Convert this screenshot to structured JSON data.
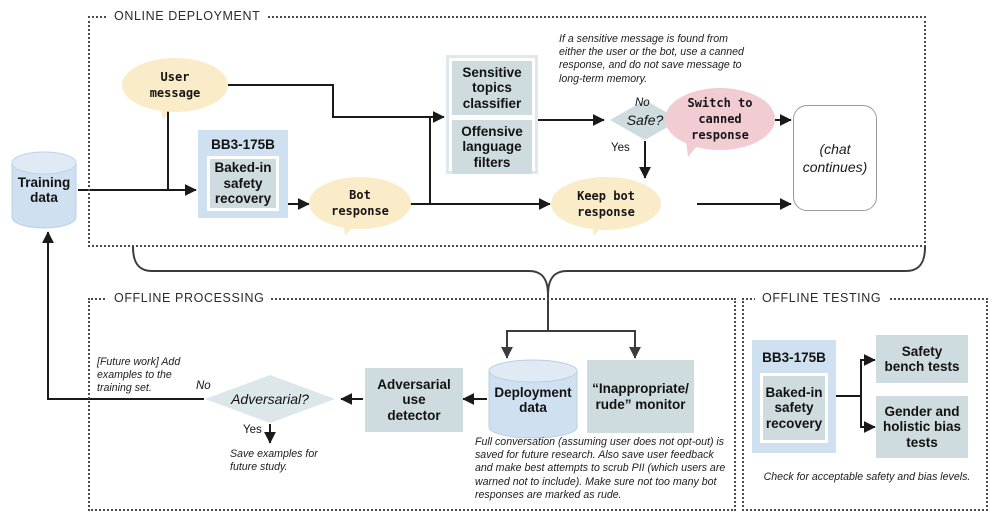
{
  "sections": {
    "online": {
      "label": "ONLINE DEPLOYMENT"
    },
    "offline_processing": {
      "label": "OFFLINE PROCESSING"
    },
    "offline_testing": {
      "label": "OFFLINE TESTING"
    }
  },
  "online": {
    "training_data": "Training\ndata",
    "user_message": "User\nmessage",
    "model_title": "BB3-175B",
    "model_inner": "Baked-in\nsafety\nrecovery",
    "bot_response": "Bot\nresponse",
    "classifier_top": "Sensitive\ntopics\nclassifier",
    "classifier_bottom": "Offensive\nlanguage\nfilters",
    "safe_decision": "Safe?",
    "label_no": "No",
    "label_yes": "Yes",
    "canned_response": "Switch to\ncanned\nresponse",
    "keep_bot_response": "Keep bot\nresponse",
    "chat_continues": "(chat\ncontinues)",
    "note_sensitive": "If a sensitive message is found from either the user or the bot, use a canned response, and do not save message to long-term memory."
  },
  "offline_processing": {
    "deployment_data": "Deployment\ndata",
    "rude_monitor": "“Inappropriate/\nrude” monitor",
    "adversarial_detector": "Adversarial\nuse\ndetector",
    "adversarial_decision": "Adversarial?",
    "label_no": "No",
    "label_yes": "Yes",
    "note_future_work": "[Future work] Add examples to the training set.",
    "note_save_examples": "Save examples for future study.",
    "note_full_conversation": "Full conversation (assuming user does not opt-out) is saved for future research. Also save user feedback and make best attempts to scrub PII (which users are warned not to include). Make sure not too many bot responses are marked as rude."
  },
  "offline_testing": {
    "model_title": "BB3-175B",
    "model_inner": "Baked-in\nsafety\nrecovery",
    "safety_bench": "Safety\nbench tests",
    "bias_tests": "Gender and\nholistic bias\ntests",
    "note_check": "Check for acceptable safety and bias levels."
  },
  "colors": {
    "blue_fill": "#cfe0f1",
    "grayblue_fill": "#cfdcdf",
    "yellow_bubble": "#faecc8",
    "pink_bubble": "#f1ccd2",
    "stroke": "#1a1a1a",
    "frame": "#4a4a4a"
  }
}
